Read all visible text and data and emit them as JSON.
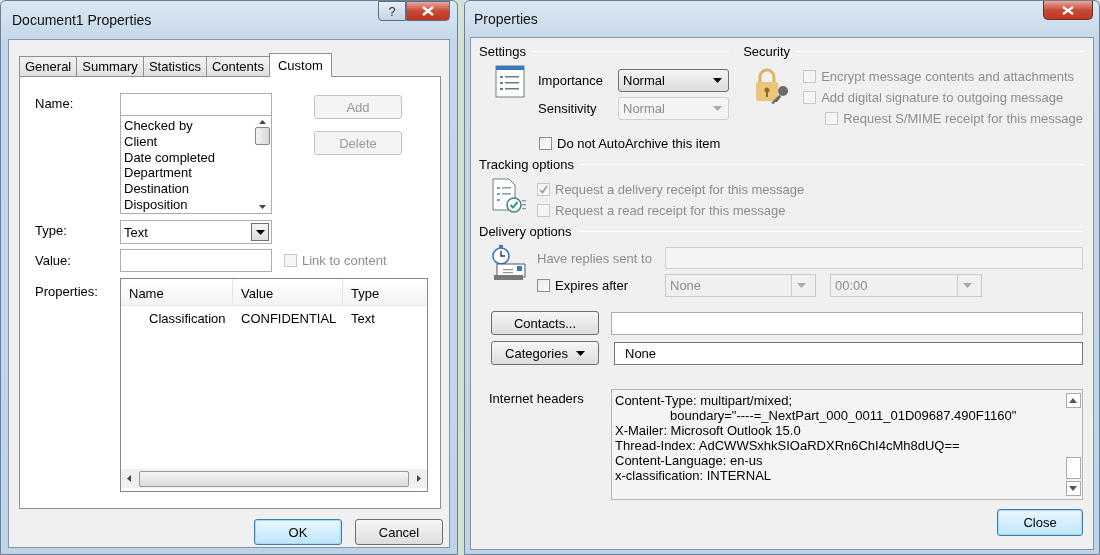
{
  "document_properties": {
    "title": "Document1 Properties",
    "help_button": "?",
    "tabs": [
      {
        "label": "General",
        "selected": false
      },
      {
        "label": "Summary",
        "selected": false
      },
      {
        "label": "Statistics",
        "selected": false
      },
      {
        "label": "Contents",
        "selected": false
      },
      {
        "label": "Custom",
        "selected": true
      }
    ],
    "name_label": "Name:",
    "name_options": [
      "Checked by",
      "Client",
      "Date completed",
      "Department",
      "Destination",
      "Disposition"
    ],
    "add_button": {
      "label": "Add",
      "disabled": true
    },
    "delete_button": {
      "label": "Delete",
      "disabled": true
    },
    "type_label": "Type:",
    "type_value": "Text",
    "value_label": "Value:",
    "link_to_content": {
      "label": "Link to content",
      "checked": false,
      "disabled": true
    },
    "properties_label": "Properties:",
    "properties_table": {
      "columns": [
        "Name",
        "Value",
        "Type"
      ],
      "rows": [
        [
          "Classification",
          "CONFIDENTIAL",
          "Text"
        ]
      ]
    },
    "buttons": [
      {
        "label": "OK",
        "default": true
      },
      {
        "label": "Cancel",
        "default": false
      }
    ]
  },
  "message_properties": {
    "title": "Properties",
    "settings": {
      "heading": "Settings",
      "importance": {
        "label": "Importance",
        "value": "Normal",
        "disabled": false
      },
      "sensitivity": {
        "label": "Sensitivity",
        "value": "Normal",
        "disabled": true
      },
      "autoarchive": {
        "label": "Do not AutoArchive this item",
        "checked": false,
        "disabled": false
      }
    },
    "security": {
      "heading": "Security",
      "options": [
        {
          "label": "Encrypt message contents and attachments",
          "checked": false,
          "disabled": true,
          "kind": "option"
        },
        {
          "label": "Add digital signature to outgoing message",
          "checked": false,
          "disabled": true,
          "kind": "option"
        },
        {
          "label": "Request S/MIME receipt for this message",
          "checked": false,
          "disabled": true,
          "kind": "sub_option"
        }
      ]
    },
    "tracking": {
      "heading": "Tracking options",
      "options": [
        {
          "label": "Request a delivery receipt for this message",
          "checked": true,
          "disabled": true
        },
        {
          "label": "Request a read receipt for this message",
          "checked": false,
          "disabled": true
        }
      ]
    },
    "delivery": {
      "heading": "Delivery options",
      "replies_label": "Have replies sent to",
      "expires": {
        "label": "Expires after",
        "checked": false,
        "disabled": false
      },
      "expires_date": "None",
      "expires_time": "00:00"
    },
    "contacts_button": "Contacts...",
    "categories_button": "Categories",
    "categories_value": "None",
    "headers_label": "Internet headers",
    "headers_lines": [
      {
        "text": "Content-Type: multipart/mixed;",
        "kind": "header"
      },
      {
        "text": "boundary=\"----=_NextPart_000_0011_01D09687.490F1160\"",
        "kind": "continuation"
      },
      {
        "text": "X-Mailer: Microsoft Outlook 15.0",
        "kind": "header"
      },
      {
        "text": "Thread-Index: AdCWWSxhkSIOaRDXRn6ChI4cMh8dUQ==",
        "kind": "header"
      },
      {
        "text": "Content-Language: en-us",
        "kind": "header"
      },
      {
        "text": "x-classification: INTERNAL",
        "kind": "header"
      }
    ],
    "close_button": "Close"
  }
}
